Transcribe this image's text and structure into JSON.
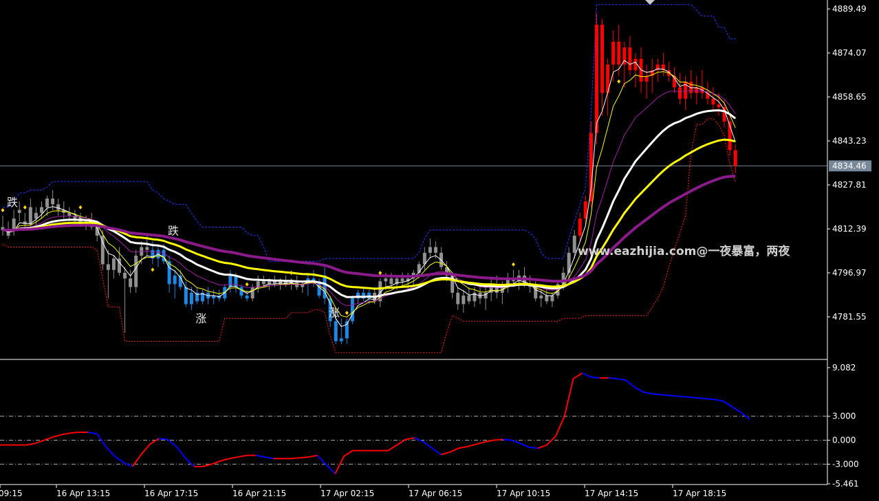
{
  "chart_data": [
    {
      "type": "candlestick",
      "pane": "main",
      "title": "",
      "xlabel": "",
      "ylabel": "",
      "ylim": [
        4770.0,
        4892.0
      ],
      "price_ticks": [
        "4889.49",
        "4874.07",
        "4858.65",
        "4843.23",
        "4827.81",
        "4812.39",
        "4796.97",
        "4781.55"
      ],
      "current_price": "4834.46",
      "colors": {
        "up": "#ff0000",
        "down": "#1e88e5",
        "neutral": "#909090",
        "grid": "#888888",
        "price_line": "#778899"
      },
      "candles": [
        [
          4813.0,
          4817.0,
          4810.0,
          4812.0
        ],
        [
          4812.0,
          4815.0,
          4809.0,
          4810.0
        ],
        [
          4816.0,
          4819.0,
          4810.0,
          4812.0
        ],
        [
          4818.0,
          4822.0,
          4815.0,
          4819.0
        ],
        [
          4815.0,
          4818.0,
          4812.0,
          4814.0
        ],
        [
          4820.0,
          4823.0,
          4812.0,
          4814.0
        ],
        [
          4816.0,
          4820.0,
          4813.0,
          4818.0
        ],
        [
          4818.0,
          4822.0,
          4816.0,
          4820.0
        ],
        [
          4820.0,
          4824.0,
          4817.0,
          4823.0
        ],
        [
          4823.0,
          4826.0,
          4819.0,
          4821.0
        ],
        [
          4821.0,
          4823.0,
          4817.0,
          4819.0
        ],
        [
          4819.0,
          4822.0,
          4816.0,
          4818.0
        ],
        [
          4818.0,
          4820.0,
          4815.0,
          4817.0
        ],
        [
          4817.0,
          4819.0,
          4814.0,
          4816.0
        ],
        [
          4816.0,
          4818.0,
          4813.0,
          4814.0
        ],
        [
          4814.0,
          4817.0,
          4812.0,
          4815.0
        ],
        [
          4815.0,
          4818.0,
          4812.0,
          4813.0
        ],
        [
          4813.0,
          4815.0,
          4808.0,
          4810.0
        ],
        [
          4810.0,
          4812.0,
          4798.0,
          4800.0
        ],
        [
          4800.0,
          4805.0,
          4788.0,
          4798.0
        ],
        [
          4798.0,
          4803.0,
          4795.0,
          4802.0
        ],
        [
          4802.0,
          4806.0,
          4796.0,
          4797.0
        ],
        [
          4797.0,
          4799.0,
          4776.0,
          4795.0
        ],
        [
          4795.0,
          4798.0,
          4790.0,
          4792.0
        ],
        [
          4792.0,
          4805.0,
          4790.0,
          4803.0
        ],
        [
          4803.0,
          4808.0,
          4800.0,
          4806.0
        ],
        [
          4806.0,
          4810.0,
          4803.0,
          4805.0
        ],
        [
          4805.0,
          4808.0,
          4800.0,
          4802.0
        ],
        [
          4802.0,
          4807.0,
          4799.0,
          4805.0
        ],
        [
          4805.0,
          4807.0,
          4800.0,
          4801.0
        ],
        [
          4801.0,
          4803.0,
          4790.0,
          4793.0
        ],
        [
          4793.0,
          4798.0,
          4788.0,
          4796.0
        ],
        [
          4796.0,
          4798.0,
          4791.0,
          4792.0
        ],
        [
          4792.0,
          4794.0,
          4785.0,
          4786.0
        ],
        [
          4786.0,
          4792.0,
          4784.0,
          4790.0
        ],
        [
          4790.0,
          4792.0,
          4786.0,
          4787.0
        ],
        [
          4787.0,
          4791.0,
          4786.0,
          4790.0
        ],
        [
          4790.0,
          4792.0,
          4786.0,
          4788.0
        ],
        [
          4788.0,
          4791.0,
          4786.0,
          4789.0
        ],
        [
          4789.0,
          4791.0,
          4787.0,
          4788.0
        ],
        [
          4788.0,
          4793.0,
          4787.0,
          4792.0
        ],
        [
          4792.0,
          4798.0,
          4790.0,
          4796.0
        ],
        [
          4796.0,
          4797.0,
          4790.0,
          4792.0
        ],
        [
          4792.0,
          4793.0,
          4788.0,
          4789.0
        ],
        [
          4789.0,
          4791.0,
          4787.0,
          4788.0
        ],
        [
          4788.0,
          4793.0,
          4787.0,
          4792.0
        ],
        [
          4792.0,
          4796.0,
          4790.0,
          4794.0
        ],
        [
          4794.0,
          4796.0,
          4792.0,
          4793.0
        ],
        [
          4793.0,
          4795.0,
          4791.0,
          4794.0
        ],
        [
          4794.0,
          4796.0,
          4792.0,
          4793.0
        ],
        [
          4793.0,
          4795.0,
          4791.0,
          4794.0
        ],
        [
          4794.0,
          4796.0,
          4792.0,
          4793.0
        ],
        [
          4793.0,
          4795.0,
          4791.0,
          4794.0
        ],
        [
          4794.0,
          4796.0,
          4791.0,
          4792.0
        ],
        [
          4792.0,
          4794.0,
          4790.0,
          4793.0
        ],
        [
          4793.0,
          4797.0,
          4789.0,
          4795.0
        ],
        [
          4795.0,
          4798.0,
          4792.0,
          4794.0
        ],
        [
          4794.0,
          4795.0,
          4788.0,
          4789.0
        ],
        [
          4796.0,
          4799.0,
          4786.0,
          4788.0
        ],
        [
          4788.0,
          4789.0,
          4778.0,
          4780.0
        ],
        [
          4780.0,
          4782.0,
          4772.0,
          4773.0
        ],
        [
          4773.0,
          4781.0,
          4772.0,
          4774.0
        ],
        [
          4774.0,
          4781.0,
          4772.0,
          4780.0
        ],
        [
          4780.0,
          4789.0,
          4779.0,
          4788.0
        ],
        [
          4788.0,
          4791.0,
          4786.0,
          4790.0
        ],
        [
          4790.0,
          4792.0,
          4787.0,
          4788.0
        ],
        [
          4788.0,
          4791.0,
          4786.0,
          4790.0
        ],
        [
          4790.0,
          4792.0,
          4786.0,
          4787.0
        ],
        [
          4787.0,
          4795.0,
          4785.0,
          4794.0
        ],
        [
          4794.0,
          4797.0,
          4791.0,
          4795.0
        ],
        [
          4795.0,
          4797.0,
          4792.0,
          4793.0
        ],
        [
          4793.0,
          4796.0,
          4791.0,
          4795.0
        ],
        [
          4795.0,
          4797.0,
          4792.0,
          4794.0
        ],
        [
          4794.0,
          4797.0,
          4791.0,
          4795.0
        ],
        [
          4795.0,
          4798.0,
          4792.0,
          4797.0
        ],
        [
          4797.0,
          4801.0,
          4795.0,
          4800.0
        ],
        [
          4800.0,
          4806.0,
          4798.0,
          4804.0
        ],
        [
          4804.0,
          4809.0,
          4802.0,
          4806.0
        ],
        [
          4806.0,
          4808.0,
          4802.0,
          4804.0
        ],
        [
          4804.0,
          4806.0,
          4798.0,
          4799.0
        ],
        [
          4799.0,
          4801.0,
          4794.0,
          4796.0
        ],
        [
          4796.0,
          4797.0,
          4788.0,
          4790.0
        ],
        [
          4790.0,
          4792.0,
          4784.0,
          4786.0
        ],
        [
          4786.0,
          4791.0,
          4783.0,
          4789.0
        ],
        [
          4789.0,
          4792.0,
          4786.0,
          4787.0
        ],
        [
          4787.0,
          4792.0,
          4785.0,
          4790.0
        ],
        [
          4790.0,
          4793.0,
          4786.0,
          4788.0
        ],
        [
          4788.0,
          4792.0,
          4784.0,
          4790.0
        ],
        [
          4790.0,
          4795.0,
          4787.0,
          4793.0
        ],
        [
          4793.0,
          4796.0,
          4788.0,
          4790.0
        ],
        [
          4790.0,
          4794.0,
          4786.0,
          4792.0
        ],
        [
          4792.0,
          4797.0,
          4790.0,
          4795.0
        ],
        [
          4795.0,
          4798.0,
          4792.0,
          4794.0
        ],
        [
          4794.0,
          4798.0,
          4791.0,
          4796.0
        ],
        [
          4796.0,
          4799.0,
          4792.0,
          4793.0
        ],
        [
          4793.0,
          4796.0,
          4790.0,
          4792.0
        ],
        [
          4792.0,
          4794.0,
          4787.0,
          4788.0
        ],
        [
          4788.0,
          4791.0,
          4785.0,
          4789.0
        ],
        [
          4789.0,
          4791.0,
          4786.0,
          4787.0
        ],
        [
          4787.0,
          4790.0,
          4785.0,
          4789.0
        ],
        [
          4789.0,
          4794.0,
          4788.0,
          4793.0
        ],
        [
          4793.0,
          4799.0,
          4791.0,
          4797.0
        ],
        [
          4797.0,
          4806.0,
          4795.0,
          4804.0
        ],
        [
          4804.0,
          4812.0,
          4802.0,
          4810.0
        ],
        [
          4810.0,
          4818.0,
          4808.0,
          4816.0
        ],
        [
          4816.0,
          4824.0,
          4814.0,
          4822.0
        ],
        [
          4822.0,
          4850.0,
          4820.0,
          4846.0
        ],
        [
          4846.0,
          4888.0,
          4842.0,
          4884.0
        ],
        [
          4884.0,
          4886.0,
          4852.0,
          4860.0
        ],
        [
          4860.0,
          4872.0,
          4852.0,
          4870.0
        ],
        [
          4870.0,
          4882.0,
          4864.0,
          4878.0
        ],
        [
          4878.0,
          4884.0,
          4866.0,
          4870.0
        ],
        [
          4870.0,
          4878.0,
          4862.0,
          4876.0
        ],
        [
          4876.0,
          4880.0,
          4866.0,
          4868.0
        ],
        [
          4868.0,
          4874.0,
          4862.0,
          4872.0
        ],
        [
          4872.0,
          4876.0,
          4860.0,
          4864.0
        ],
        [
          4864.0,
          4870.0,
          4858.0,
          4866.0
        ],
        [
          4866.0,
          4872.0,
          4860.0,
          4868.0
        ],
        [
          4868.0,
          4872.0,
          4864.0,
          4870.0
        ],
        [
          4870.0,
          4874.0,
          4866.0,
          4868.0
        ],
        [
          4868.0,
          4871.0,
          4864.0,
          4866.0
        ],
        [
          4866.0,
          4869.0,
          4860.0,
          4862.0
        ],
        [
          4862.0,
          4867.0,
          4856.0,
          4858.0
        ],
        [
          4858.0,
          4866.0,
          4854.0,
          4864.0
        ],
        [
          4864.0,
          4868.0,
          4858.0,
          4860.0
        ],
        [
          4860.0,
          4866.0,
          4856.0,
          4862.0
        ],
        [
          4862.0,
          4868.0,
          4858.0,
          4860.0
        ],
        [
          4860.0,
          4864.0,
          4856.0,
          4858.0
        ],
        [
          4858.0,
          4862.0,
          4854.0,
          4856.0
        ],
        [
          4856.0,
          4860.0,
          4852.0,
          4855.0
        ],
        [
          4855.0,
          4858.0,
          4848.0,
          4850.0
        ],
        [
          4850.0,
          4852.0,
          4838.0,
          4840.0
        ],
        [
          4840.0,
          4842.0,
          4832.0,
          4834.46
        ]
      ],
      "markers": [
        {
          "label": "跌",
          "index": 0
        },
        {
          "label": "跌",
          "index": 29
        },
        {
          "label": "涨",
          "index": 34
        },
        {
          "label": "涨",
          "index": 58
        }
      ],
      "watermark": "www.eazhijia.com@一夜暴富，两夜"
    },
    {
      "type": "line",
      "pane": "oscillator",
      "title": "",
      "ylim": [
        -5.461,
        9.082
      ],
      "tick_labels": [
        "9.082",
        "3.000",
        "0.000",
        "-3.000",
        "-5.461"
      ],
      "levels": [
        3.0,
        0.0,
        -3.0
      ],
      "colors": {
        "rising": "#ff0000",
        "falling": "#0000ff",
        "level": "#aaaaaa"
      },
      "series": [
        {
          "values": [
            -0.6,
            -0.6,
            -0.6,
            -0.6,
            -0.4,
            0.0,
            0.4,
            0.7,
            0.9,
            1.0,
            1.0,
            0.8,
            -0.8,
            -2.0,
            -2.8,
            -3.3,
            -1.8,
            -0.5,
            0.2,
            0.1,
            -0.8,
            -2.2,
            -3.3,
            -3.3,
            -3.0,
            -2.6,
            -2.3,
            -2.1,
            -1.9,
            -1.9,
            -2.1,
            -2.3,
            -2.3,
            -2.3,
            -2.2,
            -2.1,
            -1.9,
            -3.1,
            -4.2,
            -2.0,
            -1.3,
            -1.3,
            -1.3,
            -1.3,
            -1.3,
            -0.6,
            0.1,
            0.3,
            -0.2,
            -1.0,
            -1.8,
            -1.5,
            -1.0,
            -0.8,
            -0.5,
            -0.2,
            0.0,
            0.1,
            0.0,
            -0.4,
            -0.9,
            -1.0,
            -0.6,
            0.5,
            3.0,
            7.7,
            8.4,
            7.9,
            7.8,
            7.8,
            7.7,
            7.5,
            6.6,
            6.0,
            5.8,
            5.7,
            5.6,
            5.5,
            5.4,
            5.3,
            5.2,
            5.1,
            4.9,
            4.2,
            3.5,
            2.6
          ]
        }
      ]
    },
    {
      "type": "axis",
      "pane": "time",
      "x_tick_labels": [
        "09:15",
        "16 Apr 13:15",
        "16 Apr 17:15",
        "16 Apr 21:15",
        "17 Apr 02:15",
        "17 Apr 06:15",
        "17 Apr 10:15",
        "17 Apr 14:15",
        "17 Apr 18:15"
      ]
    }
  ]
}
